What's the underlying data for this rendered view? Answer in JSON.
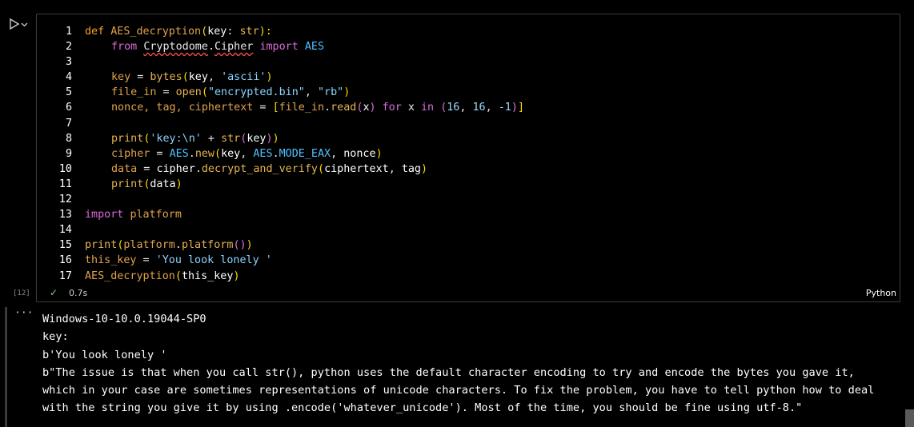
{
  "cell": {
    "run_icon": "run-triangle-icon",
    "dropdown_icon": "chevron-down-icon",
    "exec_count": "[12]",
    "status": {
      "check_icon": "check-icon",
      "duration": "0.7s",
      "language": "Python"
    }
  },
  "code_lines": [
    {
      "n": "1"
    },
    {
      "n": "2"
    },
    {
      "n": "3"
    },
    {
      "n": "4"
    },
    {
      "n": "5"
    },
    {
      "n": "6"
    },
    {
      "n": "7"
    },
    {
      "n": "8"
    },
    {
      "n": "9"
    },
    {
      "n": "10"
    },
    {
      "n": "11"
    },
    {
      "n": "12"
    },
    {
      "n": "13"
    },
    {
      "n": "14"
    },
    {
      "n": "15"
    },
    {
      "n": "16"
    },
    {
      "n": "17"
    }
  ],
  "code": {
    "l1": [
      "def",
      " ",
      "AES_decryption",
      "(",
      "key",
      ": ",
      "str",
      "):"
    ],
    "l2": [
      "from",
      " ",
      "Cryptodome",
      ".",
      "Cipher",
      " ",
      "import",
      " ",
      "AES"
    ],
    "l4": [
      "key",
      " = ",
      "bytes",
      "(",
      "key",
      ", ",
      "'ascii'",
      ")"
    ],
    "l5": [
      "file_in",
      " = ",
      "open",
      "(",
      "\"encrypted.bin\"",
      ", ",
      "\"rb\"",
      ")"
    ],
    "l6": [
      "nonce, tag, ciphertext",
      " = ",
      "[",
      "file_in",
      ".",
      "read",
      "(",
      "x",
      ")",
      " ",
      "for",
      " x ",
      "in",
      " ",
      "(",
      "16",
      ", ",
      "16",
      ", ",
      "-1",
      ")",
      "]"
    ],
    "l8": [
      "print",
      "(",
      "'key:\\n'",
      " + ",
      "str",
      "(",
      "key",
      ")",
      ")"
    ],
    "l9": [
      "cipher",
      " = ",
      "AES",
      ".",
      "new",
      "(",
      "key",
      ", ",
      "AES",
      ".",
      "MODE_EAX",
      ", ",
      "nonce",
      ")"
    ],
    "l10": [
      "data",
      " = ",
      "cipher",
      ".",
      "decrypt_and_verify",
      "(",
      "ciphertext",
      ", ",
      "tag",
      ")"
    ],
    "l11": [
      "print",
      "(",
      "data",
      ")"
    ],
    "l13": [
      "import",
      " ",
      "platform"
    ],
    "l15": [
      "print",
      "(",
      "platform",
      ".",
      "platform",
      "(",
      ")",
      ")"
    ],
    "l16": [
      "this_key",
      " = ",
      "'You look lonely '"
    ],
    "l17": [
      "AES_decryption",
      "(",
      "this_key",
      ")"
    ]
  },
  "output": {
    "ellipsis": "···",
    "text": "Windows-10-10.0.19044-SP0\nkey:\nb'You look lonely '\nb\"The issue is that when you call str(), python uses the default character encoding to try and encode the bytes you gave it,\nwhich in your case are sometimes representations of unicode characters. To fix the problem, you have to tell python how to deal\nwith the string you give it by using .encode('whatever_unicode'). Most of the time, you should be fine using utf-8.\""
  }
}
